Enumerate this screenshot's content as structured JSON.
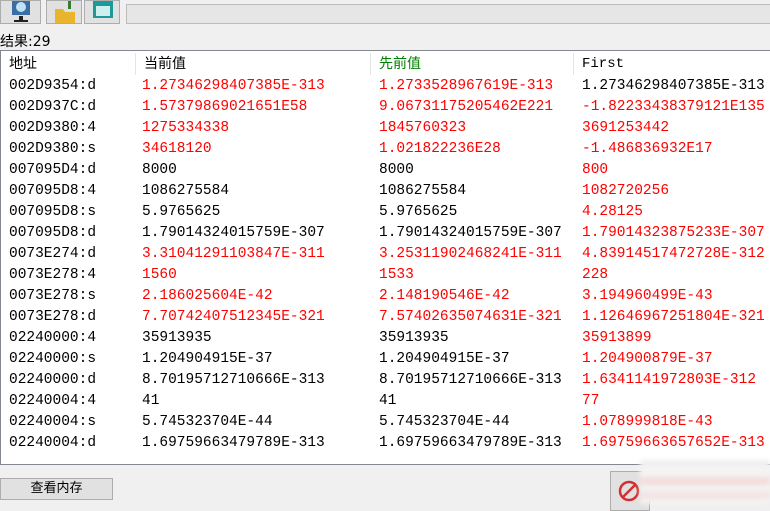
{
  "toolbar": {
    "buttons": [
      {
        "icon": "monitor-search-icon"
      },
      {
        "icon": "open-folder-icon"
      },
      {
        "icon": "save-icon"
      }
    ]
  },
  "result_count": "结果:29",
  "columns": [
    {
      "label": "地址",
      "color": "#000000"
    },
    {
      "label": "当前值",
      "color": "#000000"
    },
    {
      "label": "先前值",
      "color": "#008000"
    },
    {
      "label": "First",
      "color": "#000000"
    }
  ],
  "colors": {
    "changed": "#ff0000",
    "normal": "#000000"
  },
  "rows": [
    {
      "address": "002D9354:d",
      "current": "1.27346298407385E-313",
      "previous": "1.2733528967619E-313",
      "first": "1.27346298407385E-313",
      "red": [
        1,
        1,
        0
      ]
    },
    {
      "address": "002D937C:d",
      "current": "1.57379869021651E58",
      "previous": "9.06731175205462E221",
      "first": "-1.82233438379121E135",
      "red": [
        1,
        1,
        1
      ]
    },
    {
      "address": "002D9380:4",
      "current": "1275334338",
      "previous": "1845760323",
      "first": "3691253442",
      "red": [
        1,
        1,
        1
      ]
    },
    {
      "address": "002D9380:s",
      "current": "34618120",
      "previous": "1.021822236E28",
      "first": "-1.486836932E17",
      "red": [
        1,
        1,
        1
      ]
    },
    {
      "address": "007095D4:d",
      "current": "8000",
      "previous": "8000",
      "first": "800",
      "red": [
        0,
        0,
        1
      ]
    },
    {
      "address": "007095D8:4",
      "current": "1086275584",
      "previous": "1086275584",
      "first": "1082720256",
      "red": [
        0,
        0,
        1
      ]
    },
    {
      "address": "007095D8:s",
      "current": "5.9765625",
      "previous": "5.9765625",
      "first": "4.28125",
      "red": [
        0,
        0,
        1
      ]
    },
    {
      "address": "007095D8:d",
      "current": "1.79014324015759E-307",
      "previous": "1.79014324015759E-307",
      "first": "1.79014323875233E-307",
      "red": [
        0,
        0,
        1
      ]
    },
    {
      "address": "0073E274:d",
      "current": "3.31041291103847E-311",
      "previous": "3.25311902468241E-311",
      "first": "4.83914517472728E-312",
      "red": [
        1,
        1,
        1
      ]
    },
    {
      "address": "0073E278:4",
      "current": "1560",
      "previous": "1533",
      "first": "228",
      "red": [
        1,
        1,
        1
      ]
    },
    {
      "address": "0073E278:s",
      "current": "2.186025604E-42",
      "previous": "2.148190546E-42",
      "first": "3.194960499E-43",
      "red": [
        1,
        1,
        1
      ]
    },
    {
      "address": "0073E278:d",
      "current": "7.70742407512345E-321",
      "previous": "7.57402635074631E-321",
      "first": "1.12646967251804E-321",
      "red": [
        1,
        1,
        1
      ]
    },
    {
      "address": "02240000:4",
      "current": "35913935",
      "previous": "35913935",
      "first": "35913899",
      "red": [
        0,
        0,
        1
      ]
    },
    {
      "address": "02240000:s",
      "current": "1.204904915E-37",
      "previous": "1.204904915E-37",
      "first": "1.204900879E-37",
      "red": [
        0,
        0,
        1
      ]
    },
    {
      "address": "02240000:d",
      "current": "8.70195712710666E-313",
      "previous": "8.70195712710666E-313",
      "first": "1.6341141972803E-312",
      "red": [
        0,
        0,
        1
      ]
    },
    {
      "address": "02240004:4",
      "current": "41",
      "previous": "41",
      "first": "77",
      "red": [
        0,
        0,
        1
      ]
    },
    {
      "address": "02240004:s",
      "current": "5.745323704E-44",
      "previous": "5.745323704E-44",
      "first": "1.078999818E-43",
      "red": [
        0,
        0,
        1
      ]
    },
    {
      "address": "02240004:d",
      "current": "1.69759663479789E-313",
      "previous": "1.69759663479789E-313",
      "first": "1.69759663657652E-313",
      "red": [
        0,
        0,
        1
      ]
    }
  ],
  "bottom": {
    "view_memory_label": "查看内存",
    "stop_icon": "no-entry-icon"
  }
}
